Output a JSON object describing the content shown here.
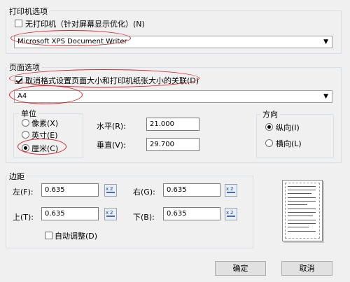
{
  "printer_section": {
    "title": "打印机选项",
    "no_printer_label": "无打印机（针对屏幕显示优化）(N)",
    "printer_value": "Microsoft XPS Document Writer"
  },
  "page_section": {
    "title": "页面选项",
    "unlink_label": "取消格式设置页面大小和打印机纸张大小的关联(D)",
    "paper_value": "A4"
  },
  "unit_section": {
    "title": "单位",
    "options": [
      "像素(X)",
      "英寸(E)",
      "厘米(C)"
    ],
    "selected": "厘米(C)"
  },
  "size": {
    "horizontal_label": "水平(R):",
    "horizontal_value": "21.000",
    "vertical_label": "垂直(V):",
    "vertical_value": "29.700"
  },
  "orientation_section": {
    "title": "方向",
    "portrait_label": "纵向(I)",
    "landscape_label": "横向(L)",
    "selected": "纵向(I)"
  },
  "margins_section": {
    "title": "边距",
    "left_label": "左(F):",
    "left_value": "0.635",
    "right_label": "右(G):",
    "right_value": "0.635",
    "top_label": "上(T):",
    "top_value": "0.635",
    "bottom_label": "下(B):",
    "bottom_value": "0.635",
    "auto_adjust_label": "自动调整(D)"
  },
  "buttons": {
    "ok": "确定",
    "cancel": "取消"
  },
  "colors": {
    "annotation_red": "#d9232b",
    "background": "#f0f0f0"
  }
}
